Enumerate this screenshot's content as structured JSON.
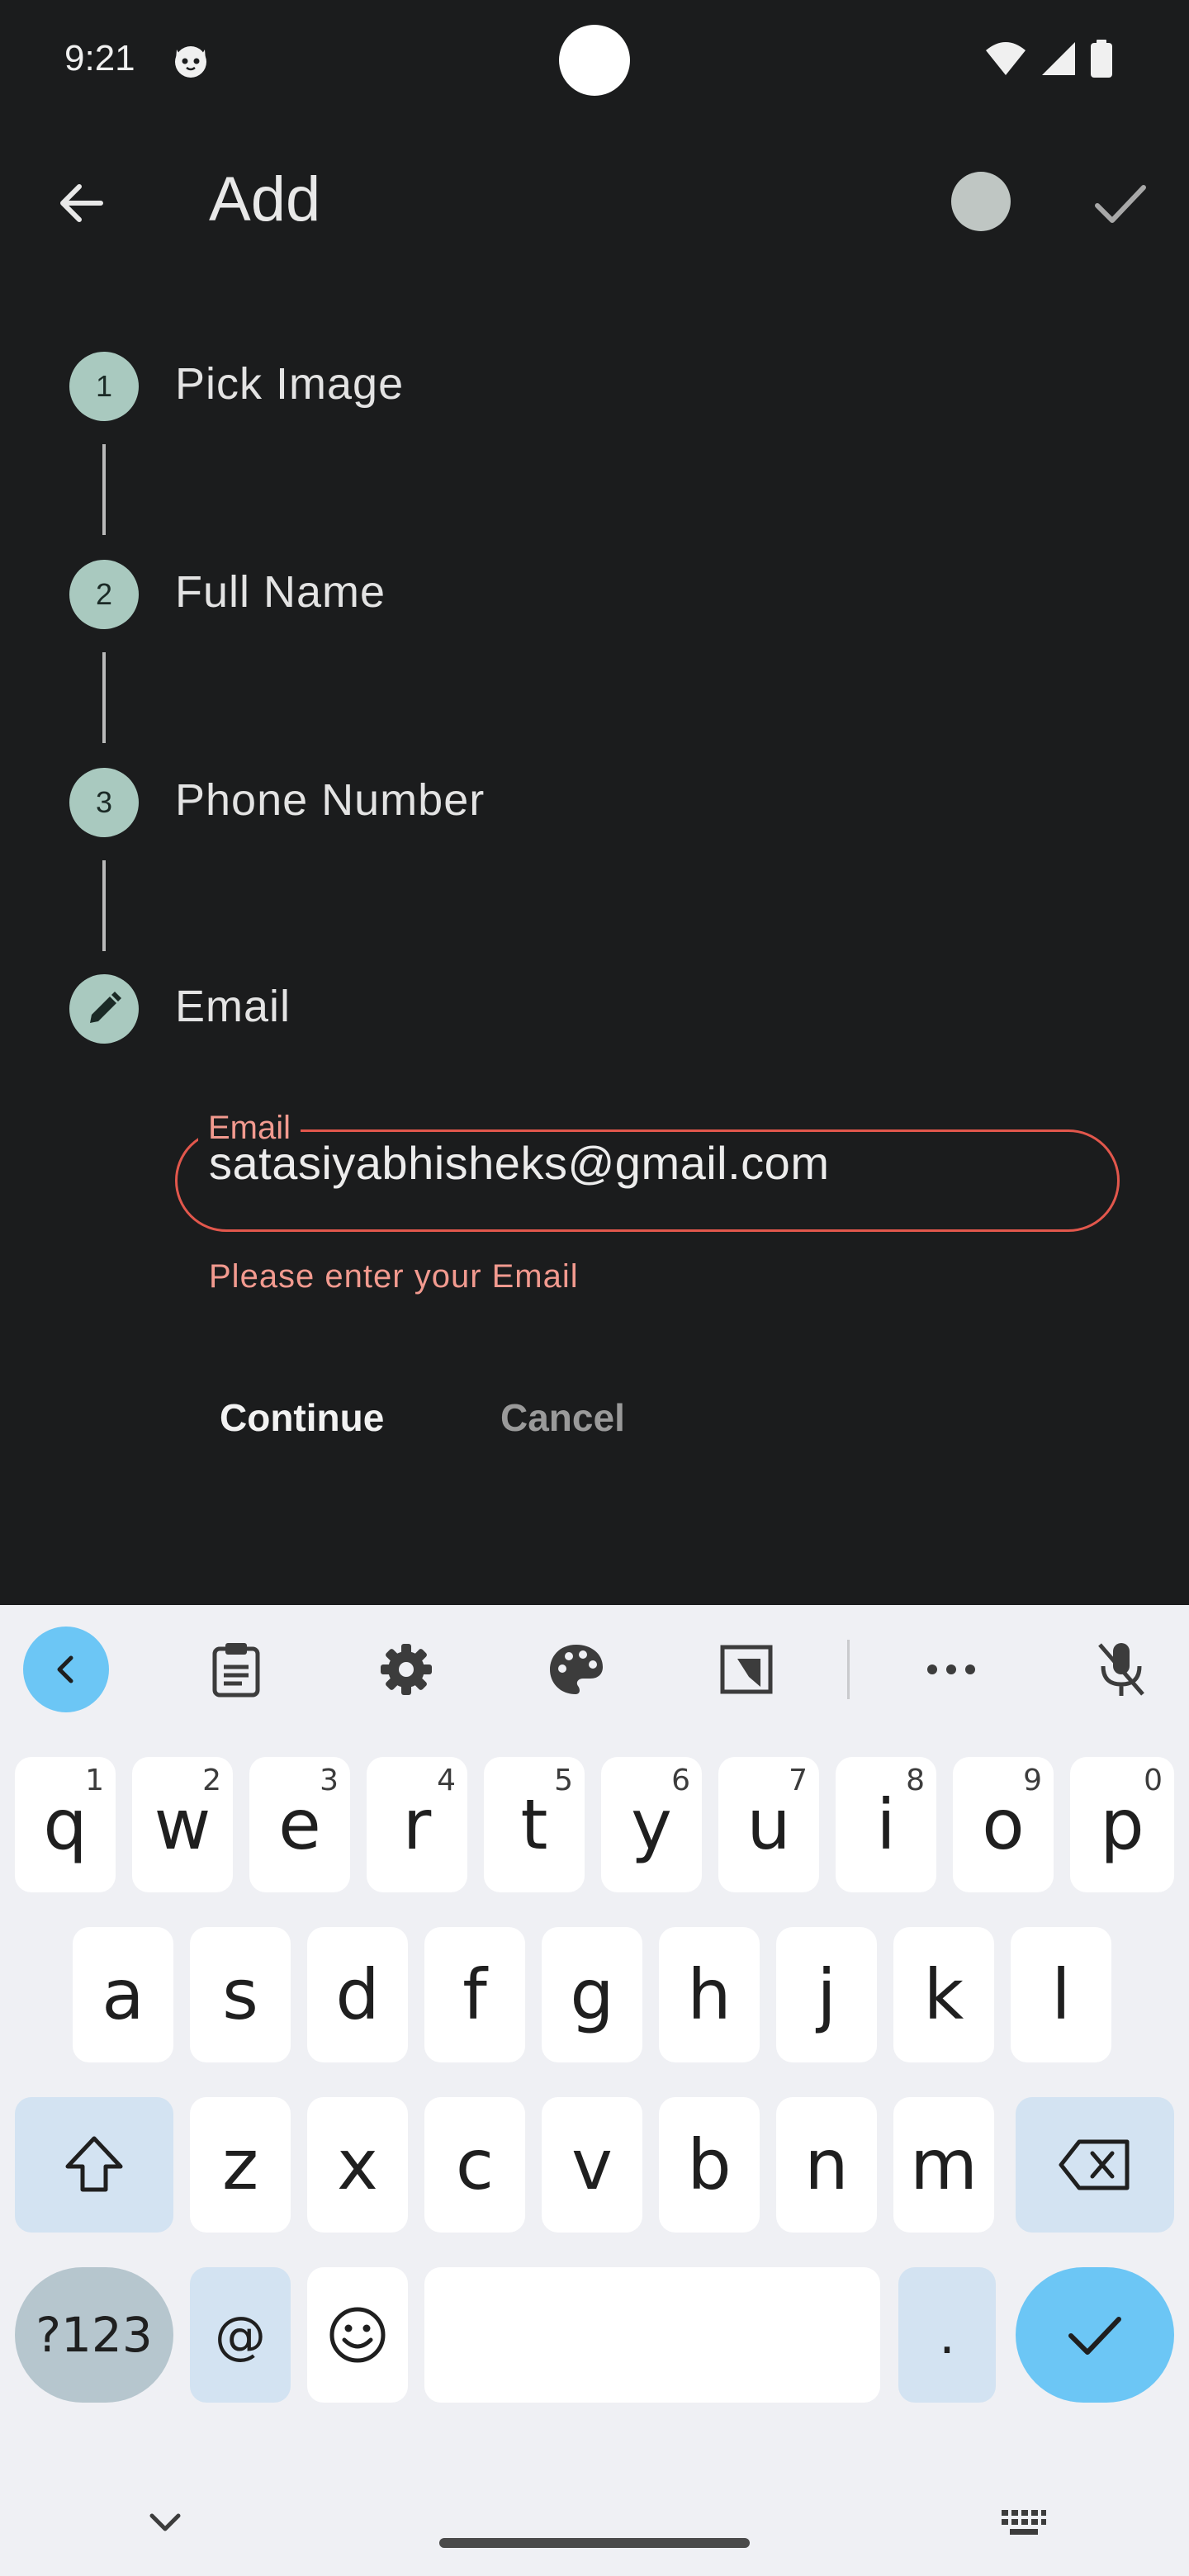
{
  "status_bar": {
    "time": "9:21"
  },
  "app_bar": {
    "title": "Add"
  },
  "stepper": {
    "steps": [
      {
        "number": "1",
        "label": "Pick Image"
      },
      {
        "number": "2",
        "label": "Full Name"
      },
      {
        "number": "3",
        "label": "Phone Number"
      },
      {
        "number": "",
        "label": "Email"
      }
    ]
  },
  "email_field": {
    "label": "Email",
    "value": "satasiyabhisheks@gmail.com",
    "error": "Please enter your Email"
  },
  "actions": {
    "continue": "Continue",
    "cancel": "Cancel"
  },
  "keyboard": {
    "row1": [
      {
        "key": "q",
        "hint": "1"
      },
      {
        "key": "w",
        "hint": "2"
      },
      {
        "key": "e",
        "hint": "3"
      },
      {
        "key": "r",
        "hint": "4"
      },
      {
        "key": "t",
        "hint": "5"
      },
      {
        "key": "y",
        "hint": "6"
      },
      {
        "key": "u",
        "hint": "7"
      },
      {
        "key": "i",
        "hint": "8"
      },
      {
        "key": "o",
        "hint": "9"
      },
      {
        "key": "p",
        "hint": "0"
      }
    ],
    "row2": [
      "a",
      "s",
      "d",
      "f",
      "g",
      "h",
      "j",
      "k",
      "l"
    ],
    "row3": [
      "z",
      "x",
      "c",
      "v",
      "b",
      "n",
      "m"
    ],
    "symbols": "?123",
    "at": "@",
    "period": "."
  },
  "colors": {
    "background": "#1b1c1d",
    "step_accent": "#a9c9bf",
    "error": "#e2574c",
    "error_text": "#f29a8f",
    "keyboard_bg": "#eff0f4",
    "keyboard_accent": "#6cc6f5"
  }
}
